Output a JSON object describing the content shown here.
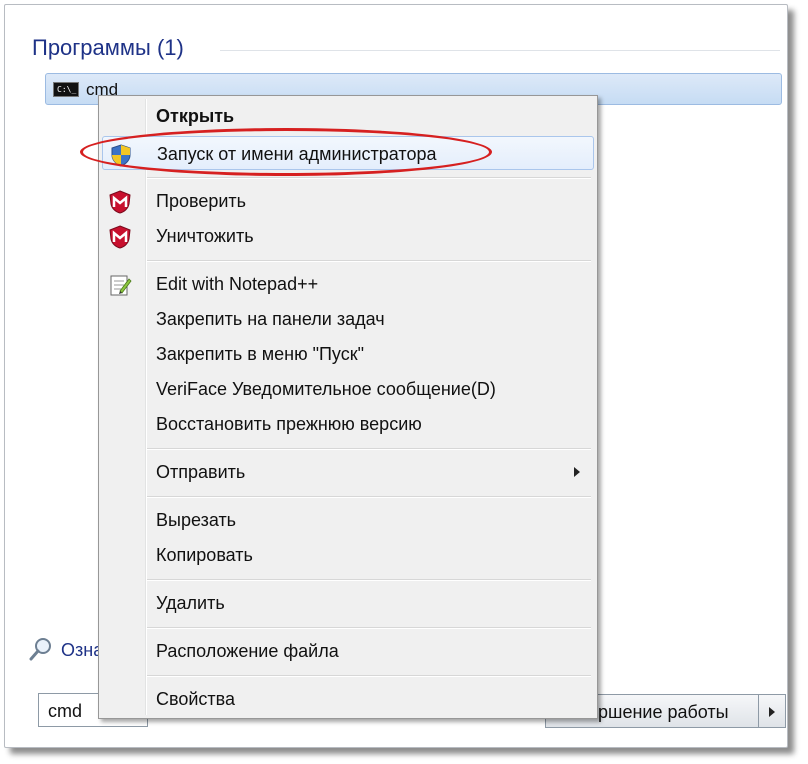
{
  "programs": {
    "section_title": "Программы (1)",
    "result": {
      "label": "cmd",
      "icon": "cmd-console-icon",
      "icon_text": "C:\\_"
    }
  },
  "see_more": {
    "label": "Озна",
    "icon": "magnifier-icon"
  },
  "search": {
    "value": "cmd"
  },
  "shutdown": {
    "label": "ршение работы",
    "arrow_icon": "triangle-right-icon"
  },
  "context_menu": {
    "items": [
      {
        "label": "Открыть",
        "bold": true
      },
      {
        "label": "Запуск от имени администратора",
        "icon": "uac-shield-icon",
        "highlighted": true
      },
      {
        "label": "Проверить",
        "icon": "mcafee-shield-icon"
      },
      {
        "label": "Уничтожить",
        "icon": "mcafee-shield-icon"
      },
      {
        "label": "Edit with Notepad++",
        "icon": "notepad-plus-plus-icon"
      },
      {
        "label": "Закрепить на панели задач"
      },
      {
        "label": "Закрепить в меню \"Пуск\""
      },
      {
        "label": "VeriFace Уведомительное сообщение(D)"
      },
      {
        "label": "Восстановить прежнюю версию"
      },
      {
        "label": "Отправить",
        "submenu": true
      },
      {
        "label": "Вырезать"
      },
      {
        "label": "Копировать"
      },
      {
        "label": "Удалить"
      },
      {
        "label": "Расположение файла"
      },
      {
        "label": "Свойства"
      }
    ]
  },
  "colors": {
    "accent_title": "#1e3287",
    "annotation_red": "#d62020",
    "menu_bg": "#f0f0f0",
    "selection_blue": "#c6dcf4"
  }
}
